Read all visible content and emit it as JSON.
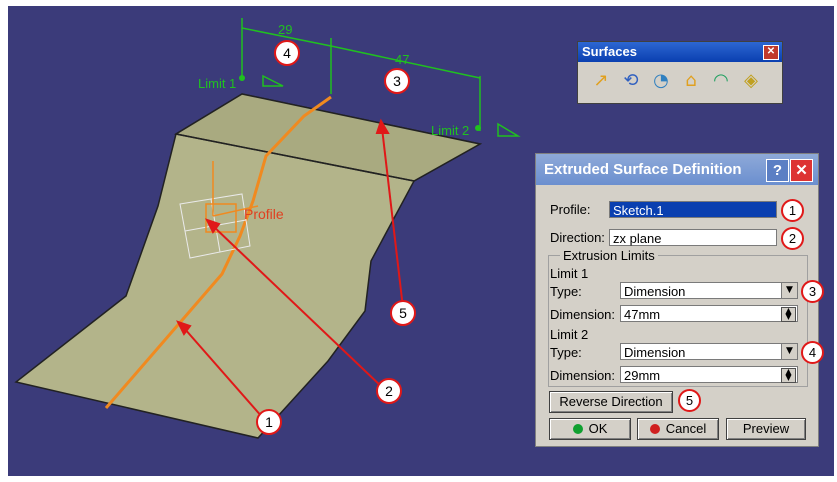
{
  "viewport": {
    "labels": {
      "limit1": "Limit 1",
      "limit2": "Limit 2",
      "profile": "Profile",
      "dim29": "29",
      "dim47": "47"
    },
    "callouts": [
      "1",
      "2",
      "3",
      "4",
      "5"
    ],
    "colors": {
      "background": "#3b3b7a",
      "surface": "#b3b48a",
      "profile_line": "#f08a20",
      "dimension": "#20c020",
      "callout_border": "#e01818"
    }
  },
  "toolbar": {
    "title": "Surfaces",
    "close": "✕",
    "icons": [
      "extrude-icon",
      "revolve-icon",
      "sphere-icon",
      "cylinder-icon",
      "offset-icon",
      "sweep-icon"
    ]
  },
  "dialog": {
    "title": "Extruded Surface Definition",
    "help": "?",
    "close": "✕",
    "profile_label": "Profile:",
    "profile_value": "Sketch.1",
    "direction_label": "Direction:",
    "direction_value": "zx plane",
    "group_label": "Extrusion Limits",
    "limit1_label": "Limit 1",
    "type_label": "Type:",
    "limit1_type": "Dimension",
    "dimension_label": "Dimension:",
    "limit1_dimension": "47mm",
    "limit2_label": "Limit 2",
    "limit2_type": "Dimension",
    "limit2_dimension": "29mm",
    "reverse_label": "Reverse Direction",
    "ok_label": "OK",
    "cancel_label": "Cancel",
    "preview_label": "Preview",
    "callouts": [
      "1",
      "2",
      "3",
      "4",
      "5"
    ]
  }
}
